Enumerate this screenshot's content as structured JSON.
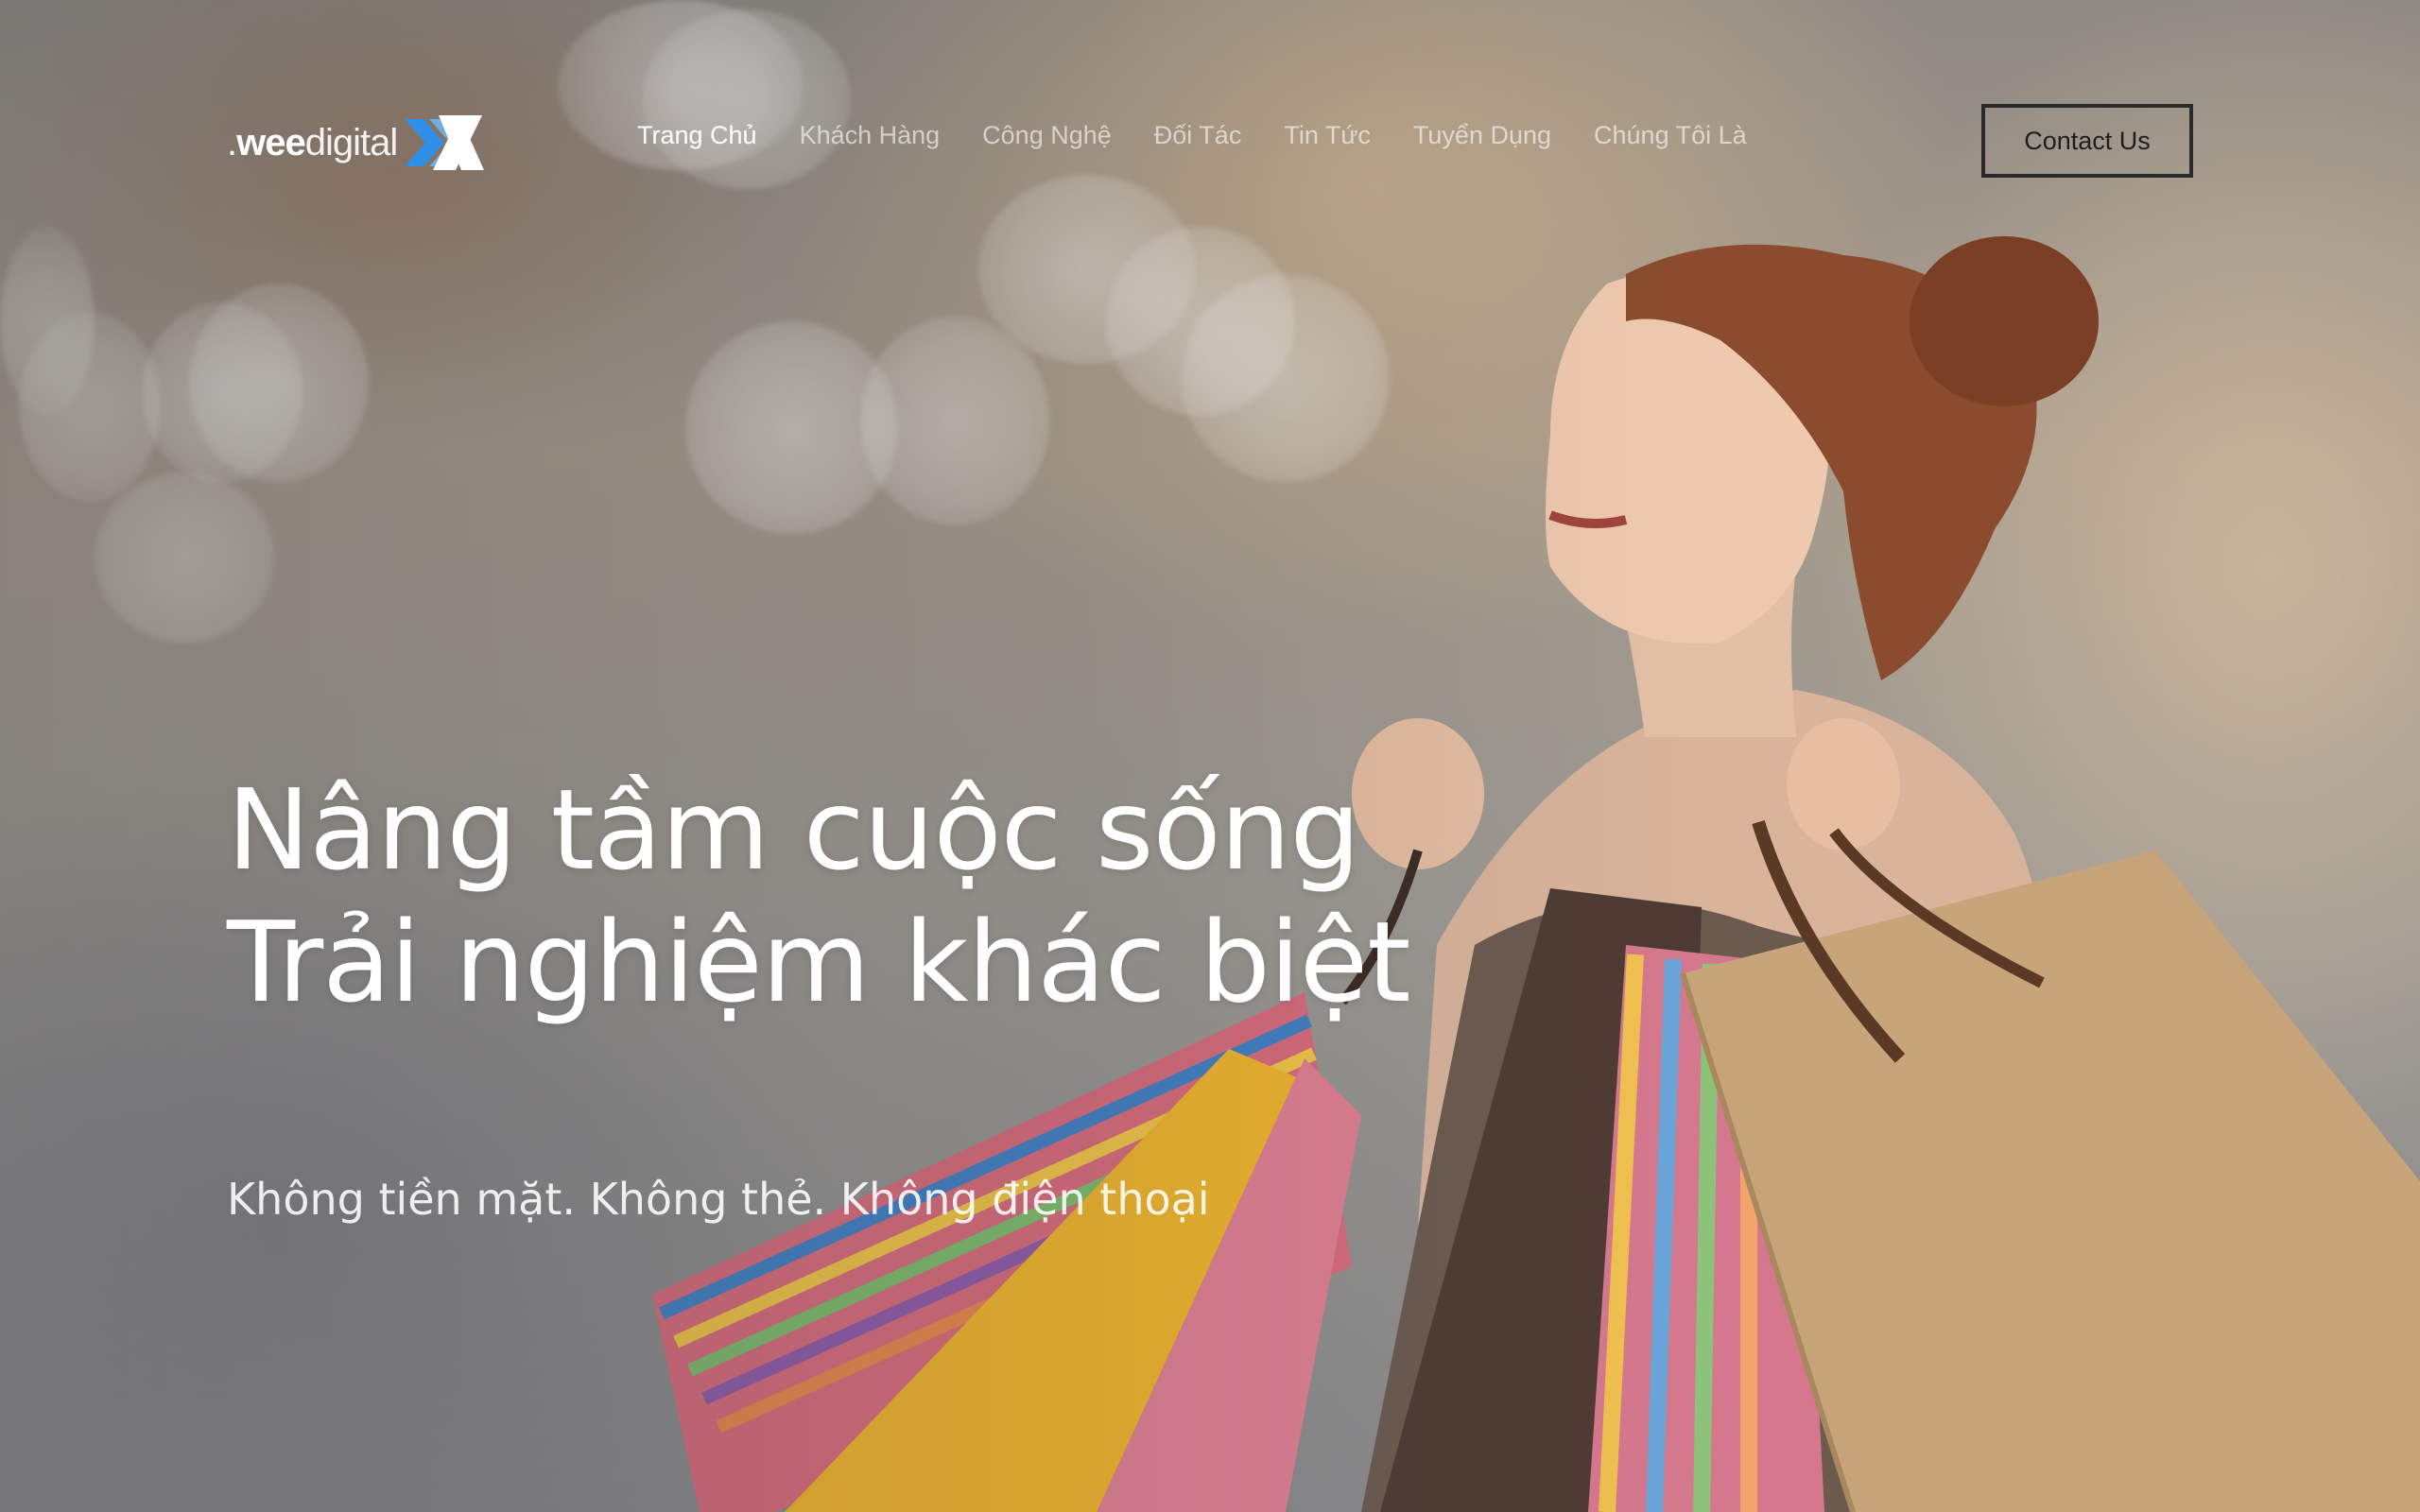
{
  "brand": {
    "logo_prefix": ".",
    "logo_wee": "wee",
    "logo_digital": "digital",
    "logo_mark_colors": [
      "#2f8fe8",
      "#ffffff"
    ]
  },
  "nav": {
    "items": [
      {
        "label": "Trang Chủ",
        "active": true
      },
      {
        "label": "Khách Hàng",
        "active": false
      },
      {
        "label": "Công Nghệ",
        "active": false
      },
      {
        "label": "Đối Tác",
        "active": false
      },
      {
        "label": "Tin Tức",
        "active": false
      },
      {
        "label": "Tuyển Dụng",
        "active": false
      },
      {
        "label": "Chúng Tôi Là",
        "active": false
      }
    ],
    "contact_label": "Contact Us"
  },
  "hero": {
    "headline_line1": "Nâng tầm cuộc sống",
    "headline_line2": "Trải nghiệm khác biệt",
    "subline": "Không tiền mặt. Không thẻ. Không điện thoại"
  },
  "colors": {
    "text_primary": "#ffffff",
    "text_muted": "rgba(255,255,255,0.6)",
    "button_border": "#2a2a2a"
  }
}
